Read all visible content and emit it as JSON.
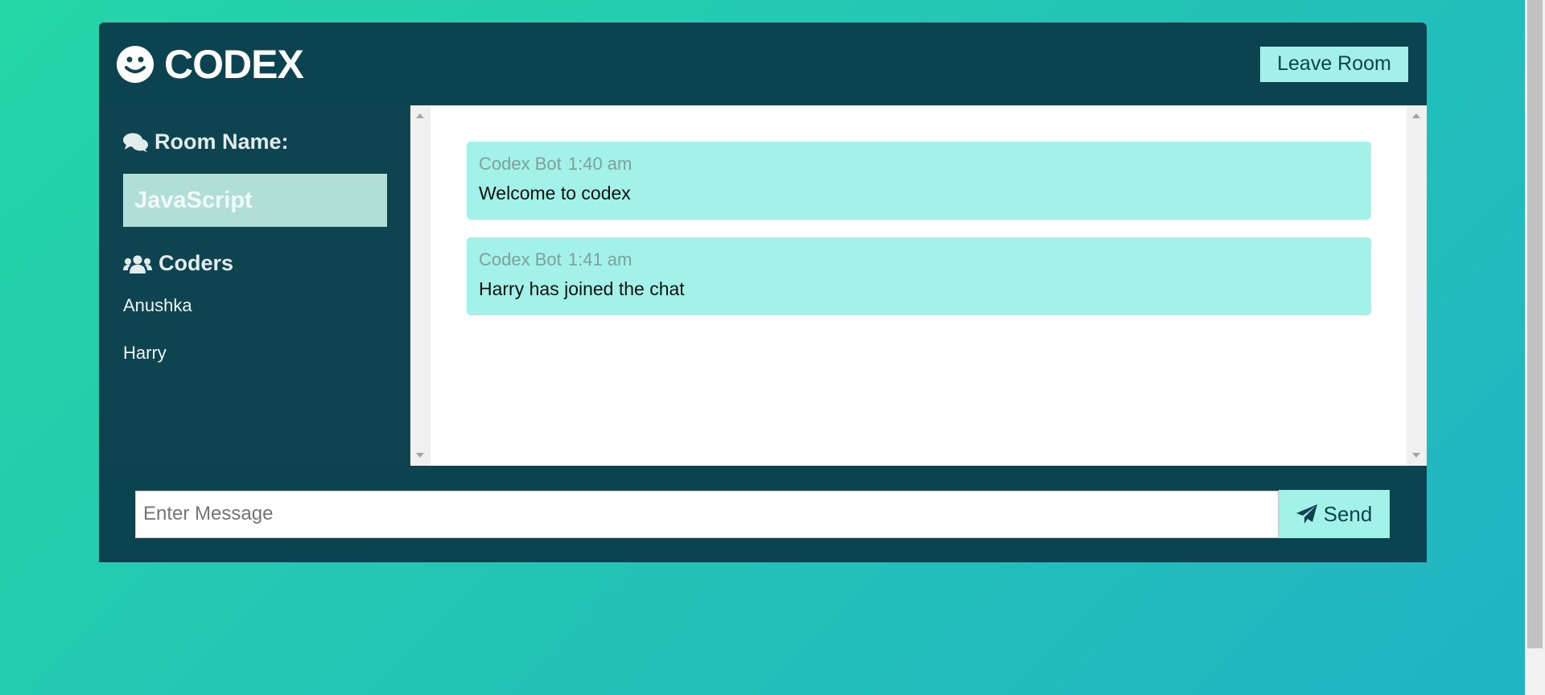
{
  "header": {
    "brand_title": "CODEX",
    "logo_icon": "smile-icon",
    "leave_label": "Leave Room"
  },
  "sidebar": {
    "room_heading": "Room Name:",
    "room_heading_icon": "comments-icon",
    "room_name": "JavaScript",
    "users_heading": "Coders",
    "users_heading_icon": "users-icon",
    "users": [
      "Anushka",
      "Harry"
    ]
  },
  "messages": [
    {
      "username": "Codex Bot",
      "time": "1:40 am",
      "text": "Welcome to codex"
    },
    {
      "username": "Codex Bot",
      "time": "1:41 am",
      "text": "Harry has joined the chat"
    }
  ],
  "form": {
    "placeholder": "Enter Message",
    "send_label": "Send",
    "send_icon": "paper-plane-icon"
  },
  "colors": {
    "accent": "#a3f0ea",
    "panel": "#0b4450",
    "sidebar": "#0e4350",
    "room_box": "#b1ded6"
  }
}
